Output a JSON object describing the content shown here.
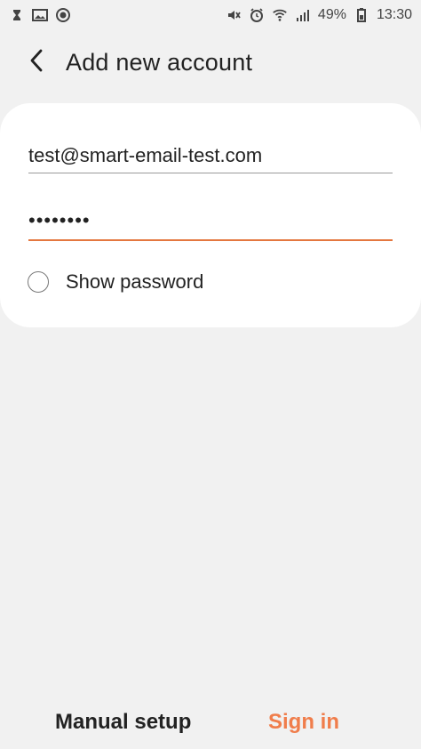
{
  "status_bar": {
    "battery_text": "49%",
    "time_text": "13:30",
    "left_icons": [
      "hourglass-icon",
      "image-icon",
      "record-icon"
    ],
    "right_icons": [
      "mute-icon",
      "alarm-icon",
      "wifi-icon",
      "signal-icon",
      "battery-icon"
    ]
  },
  "header": {
    "title": "Add new account",
    "back_icon": "back-arrow-icon"
  },
  "form": {
    "email_value": "test@smart-email-test.com",
    "password_value": "••••••••",
    "show_password_label": "Show password"
  },
  "actions": {
    "manual_setup_label": "Manual setup",
    "sign_in_label": "Sign in"
  },
  "colors": {
    "background": "#f1f1f1",
    "card": "#ffffff",
    "accent": "#f07d4b",
    "text": "#222222"
  }
}
